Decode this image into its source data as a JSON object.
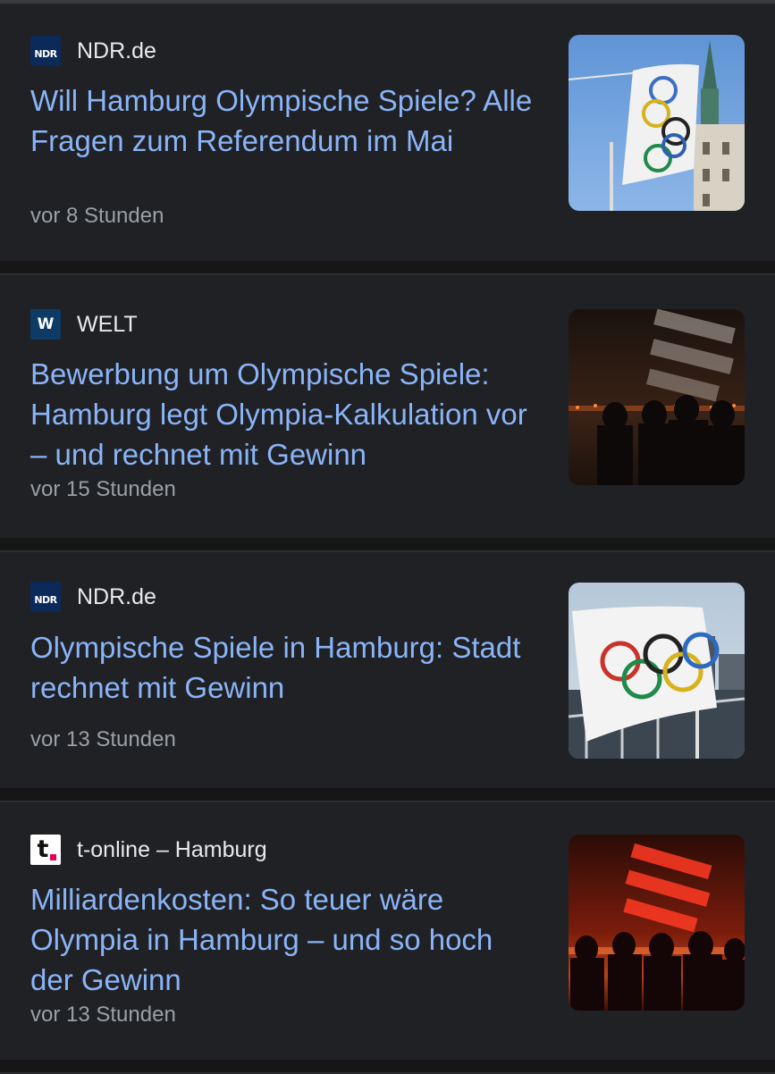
{
  "feed": {
    "articles": [
      {
        "source": "NDR.de",
        "favicon_icon": "ndr-logo-icon",
        "favicon_text": "NDR",
        "headline": "Will Hamburg Olympische Spiele? Alle Fragen zum Referendum im Mai",
        "time": "vor 8 Stunden",
        "thumbnail": "olympic-flag-city-hall-photo"
      },
      {
        "source": "WELT",
        "favicon_icon": "welt-logo-icon",
        "favicon_text": "W",
        "headline": "Bewerbung um Olympische Spiele: Hamburg legt Olympia-Kalkulation vor – und rechnet mit Gewinn",
        "time": "vor 15 Stunden",
        "thumbnail": "drone-show-night-photo"
      },
      {
        "source": "NDR.de",
        "favicon_icon": "ndr-logo-icon",
        "favicon_text": "NDR",
        "headline": "Olympische Spiele in Hamburg: Stadt rechnet mit Gewinn",
        "time": "vor 13 Stunden",
        "thumbnail": "olympic-flag-harbor-photo"
      },
      {
        "source": "t-online – Hamburg",
        "favicon_icon": "t-online-logo-icon",
        "favicon_text": "t",
        "headline": "Milliardenkosten: So teuer wäre Olympia in Hamburg – und so hoch der Gewinn",
        "time": "vor 13 Stunden",
        "thumbnail": "red-drone-show-night-photo"
      }
    ]
  },
  "colors": {
    "background": "#161616",
    "card": "#202124",
    "headline": "#8ab4f8",
    "source": "#e8eaed",
    "timestamp": "#9aa0a6"
  }
}
